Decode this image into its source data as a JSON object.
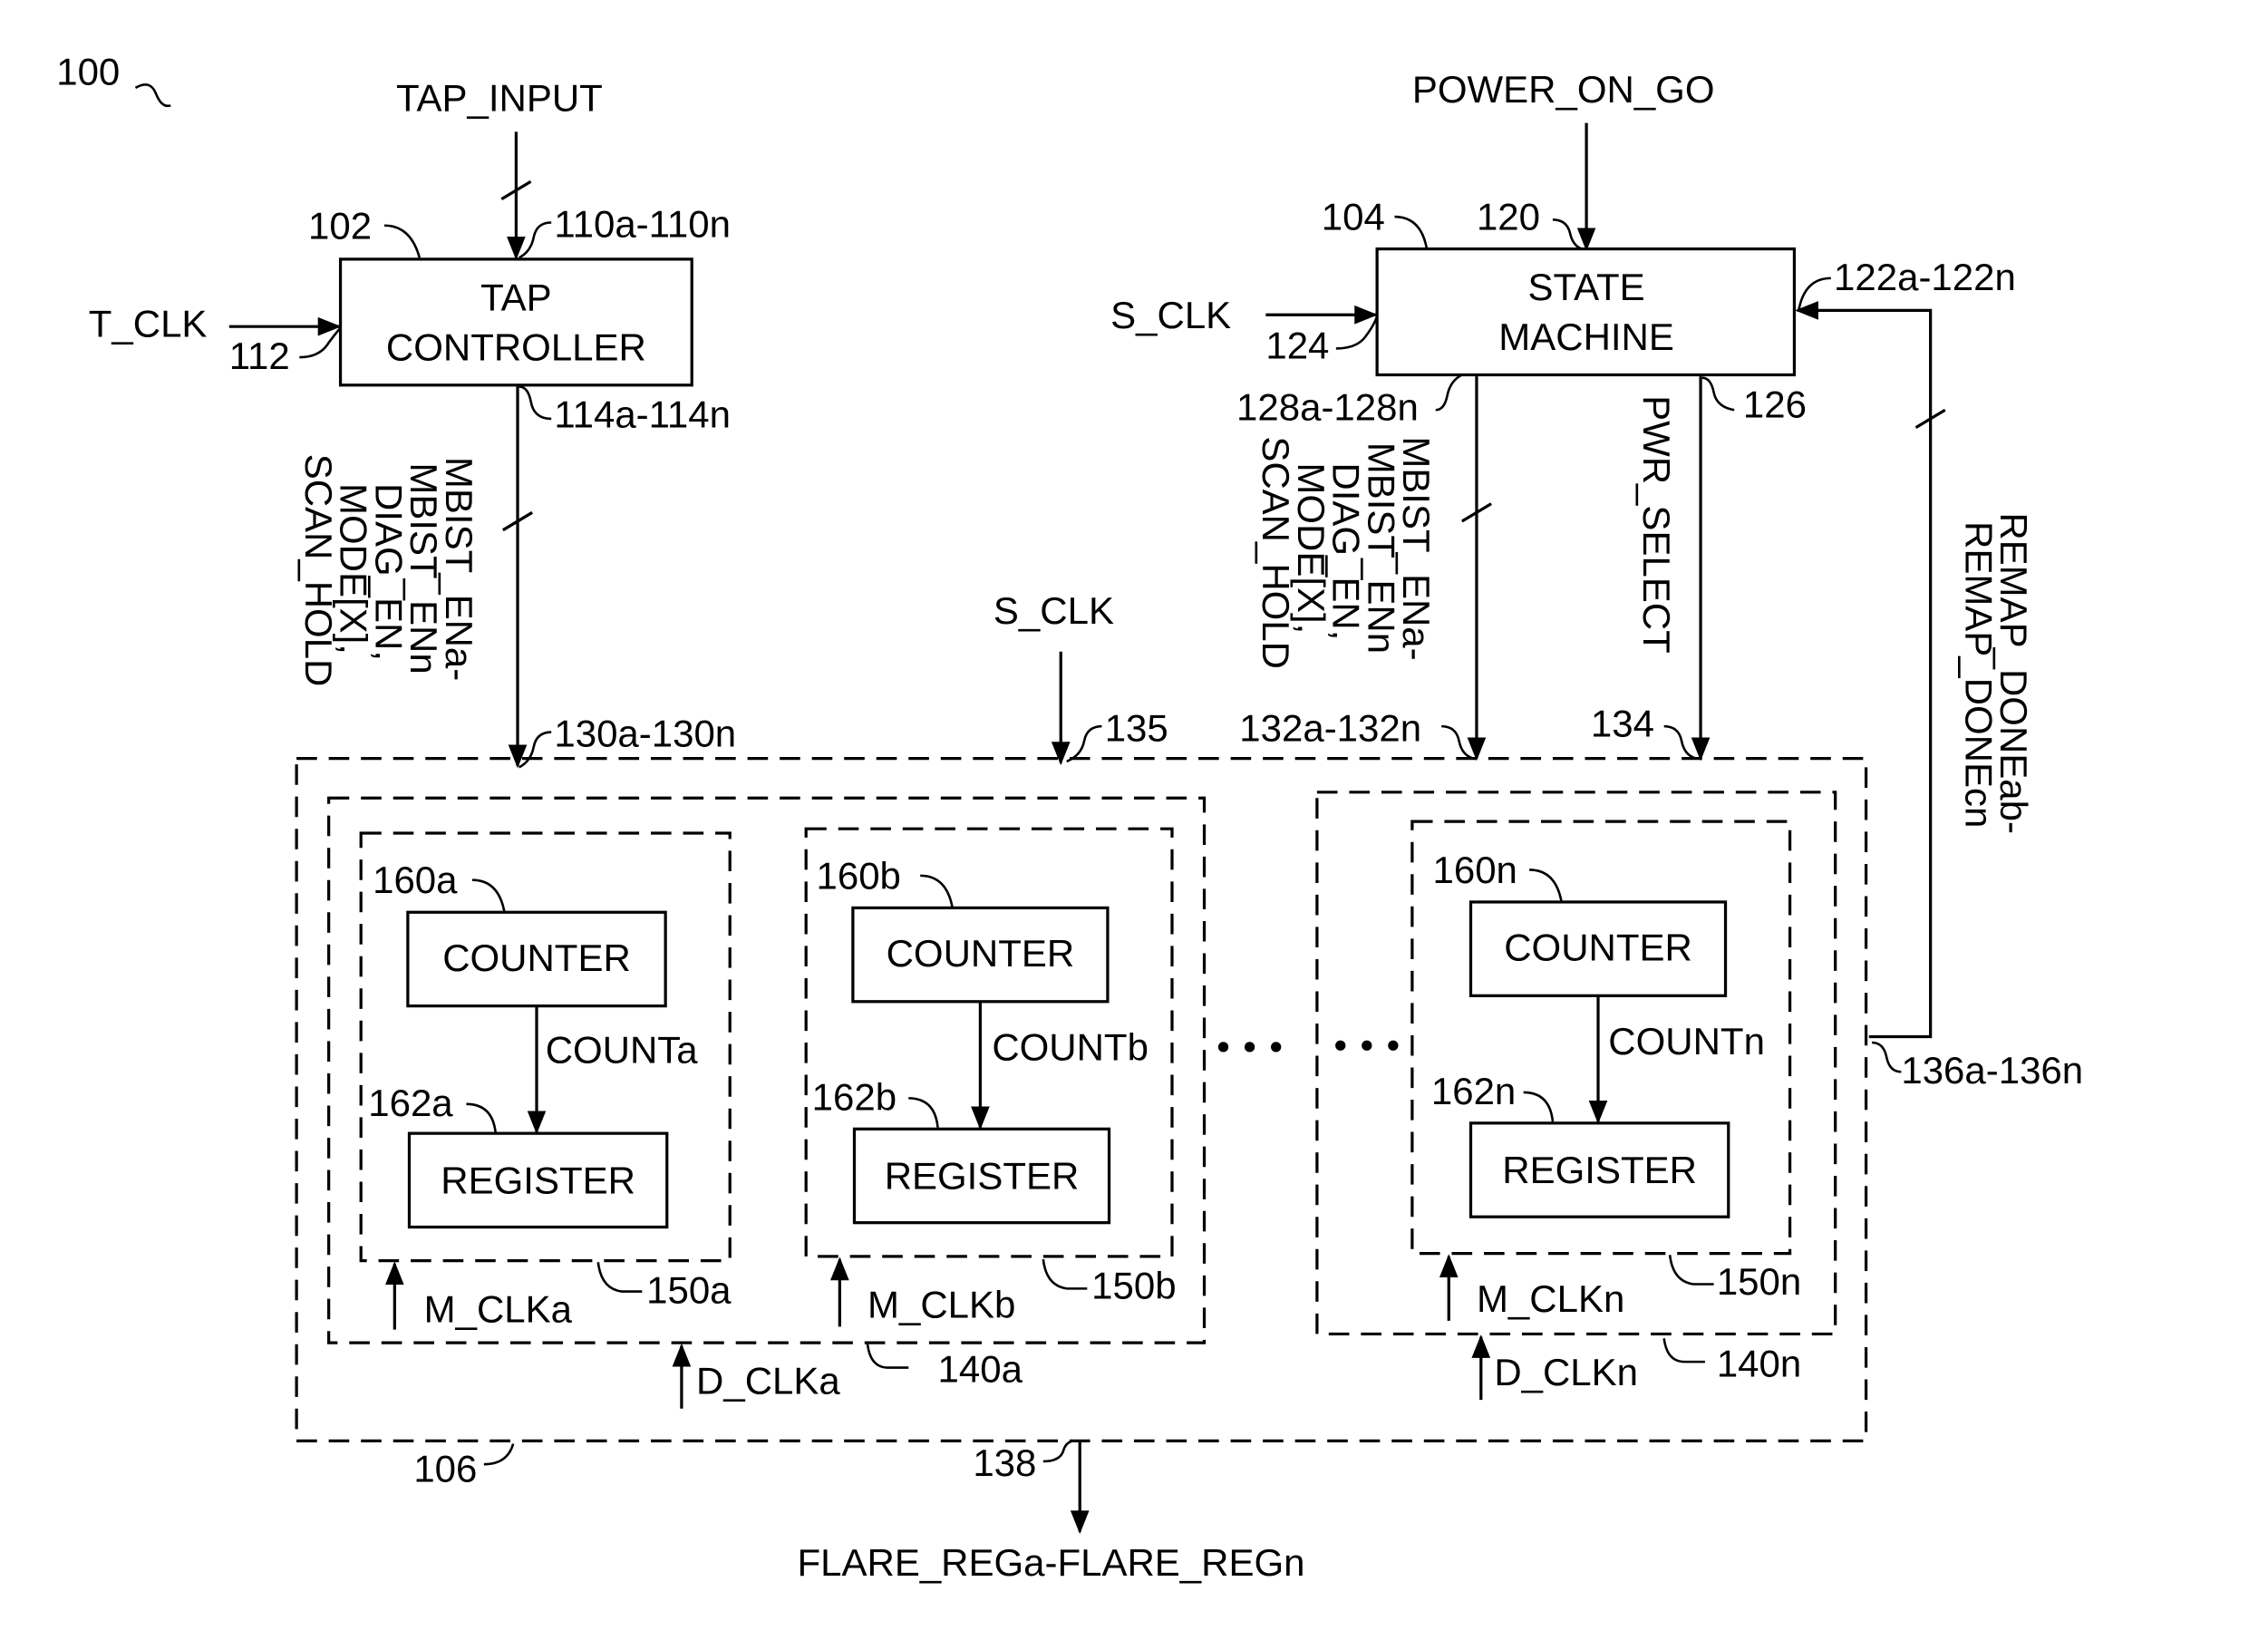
{
  "figure_ref": "100",
  "inputs": {
    "tap_input": "TAP_INPUT",
    "power_on_go": "POWER_ON_GO",
    "t_clk": "T_CLK",
    "s_clk_state": "S_CLK",
    "s_clk_bank": "S_CLK"
  },
  "blocks": {
    "tap_controller": {
      "ref": "102",
      "line1": "TAP",
      "line2": "CONTROLLER"
    },
    "state_machine": {
      "ref": "104",
      "line1": "STATE",
      "line2": "MACHINE"
    },
    "bank": {
      "ref": "106"
    }
  },
  "refs": {
    "r110": "110a-110n",
    "r112": "112",
    "r114": "114a-114n",
    "r120": "120",
    "r122": "122a-122n",
    "r124": "124",
    "r126": "126",
    "r128": "128a-128n",
    "r130": "130a-130n",
    "r132": "132a-132n",
    "r134": "134",
    "r135": "135",
    "r136": "136a-136n",
    "r138": "138"
  },
  "signals": {
    "tap_bus": [
      "MBIST_ENa-",
      "MBIST_ENn",
      "DIAG_EN,",
      "MODE[X],",
      "SCAN_HOLD"
    ],
    "sm_bus": [
      "MBIST_ENa-",
      "MBIST_ENn",
      "DIAG_EN,",
      "MODE[X],",
      "SCAN_HOLD"
    ],
    "pwr_select": "PWR_SELECT",
    "remap_done": [
      "REMAP_DONEab-",
      "REMAP_DONEcn"
    ],
    "flare": "FLARE_REGa-FLARE_REGn"
  },
  "groups": [
    {
      "ref": "140a",
      "clk": "D_CLKa",
      "units": [
        {
          "ref": "150a",
          "clk": "M_CLKa",
          "counter_ref": "160a",
          "register_ref": "162a",
          "counter": "COUNTER",
          "register": "REGISTER",
          "count": "COUNTa"
        },
        {
          "ref": "150b",
          "clk": "M_CLKb",
          "counter_ref": "160b",
          "register_ref": "162b",
          "counter": "COUNTER",
          "register": "REGISTER",
          "count": "COUNTb"
        }
      ]
    },
    {
      "ref": "140n",
      "clk": "D_CLKn",
      "units": [
        {
          "ref": "150n",
          "clk": "M_CLKn",
          "counter_ref": "160n",
          "register_ref": "162n",
          "counter": "COUNTER",
          "register": "REGISTER",
          "count": "COUNTn"
        }
      ]
    }
  ]
}
